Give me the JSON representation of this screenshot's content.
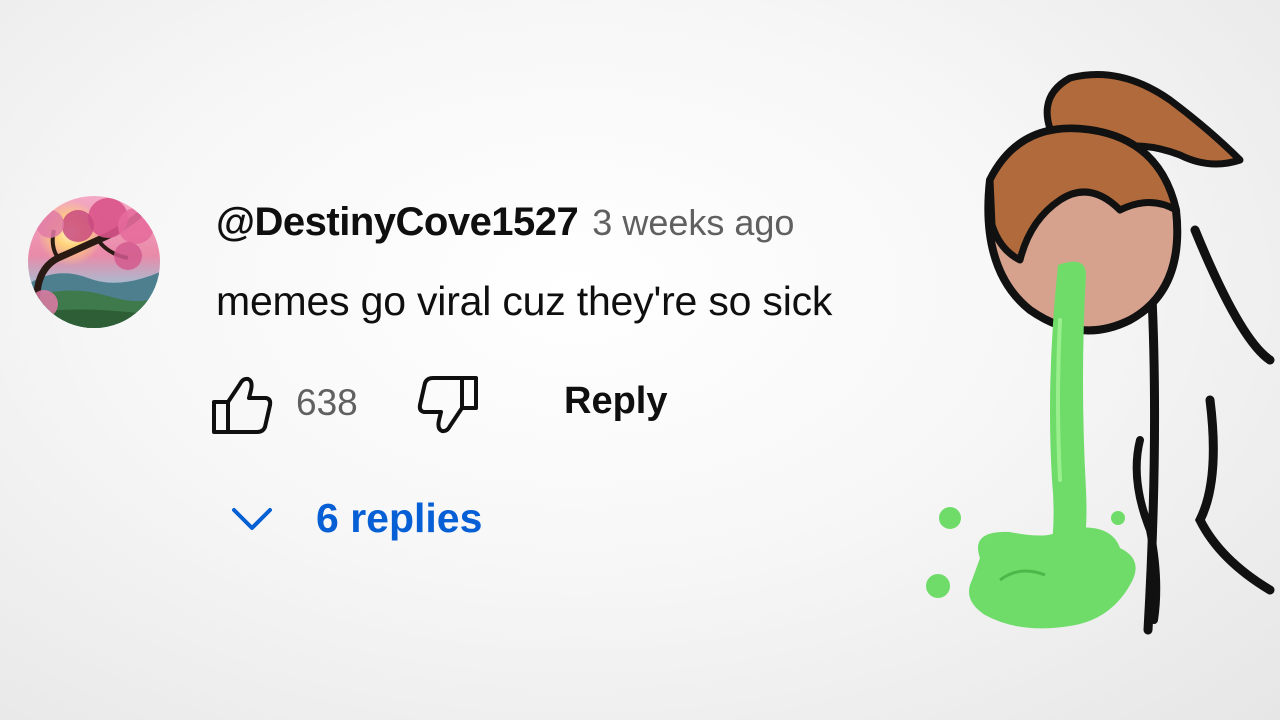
{
  "comment": {
    "author": "@DestinyCove1527",
    "time": "3 weeks ago",
    "text": "memes go viral cuz they're so sick",
    "like_count": "638",
    "reply_label": "Reply",
    "replies_label": "6 replies",
    "accent_color": "#065fd4"
  },
  "icons": {
    "avatar": "cherry-blossom-avatar",
    "like": "thumbs-up-icon",
    "dislike": "thumbs-down-icon",
    "expand": "chevron-down-icon"
  }
}
